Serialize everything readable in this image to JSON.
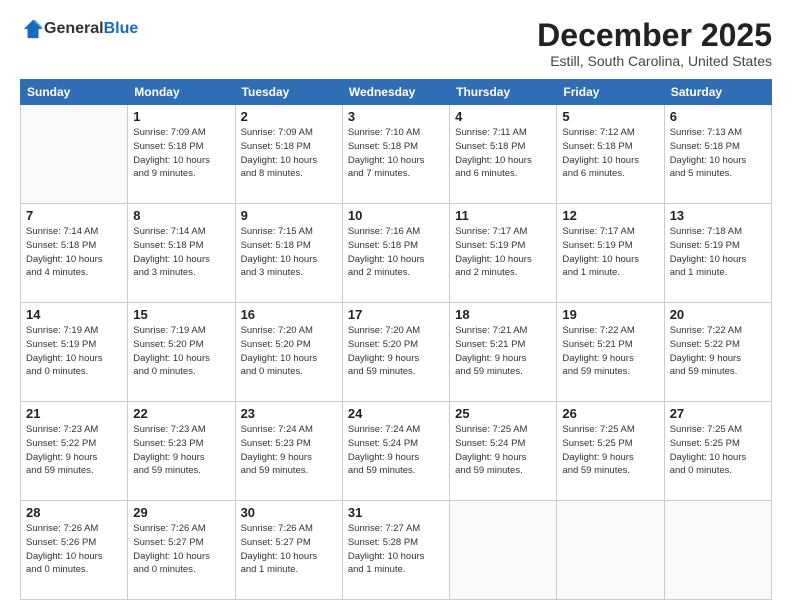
{
  "header": {
    "logo_general": "General",
    "logo_blue": "Blue",
    "month": "December 2025",
    "location": "Estill, South Carolina, United States"
  },
  "weekdays": [
    "Sunday",
    "Monday",
    "Tuesday",
    "Wednesday",
    "Thursday",
    "Friday",
    "Saturday"
  ],
  "weeks": [
    [
      {
        "day": "",
        "text": ""
      },
      {
        "day": "1",
        "text": "Sunrise: 7:09 AM\nSunset: 5:18 PM\nDaylight: 10 hours\nand 9 minutes."
      },
      {
        "day": "2",
        "text": "Sunrise: 7:09 AM\nSunset: 5:18 PM\nDaylight: 10 hours\nand 8 minutes."
      },
      {
        "day": "3",
        "text": "Sunrise: 7:10 AM\nSunset: 5:18 PM\nDaylight: 10 hours\nand 7 minutes."
      },
      {
        "day": "4",
        "text": "Sunrise: 7:11 AM\nSunset: 5:18 PM\nDaylight: 10 hours\nand 6 minutes."
      },
      {
        "day": "5",
        "text": "Sunrise: 7:12 AM\nSunset: 5:18 PM\nDaylight: 10 hours\nand 6 minutes."
      },
      {
        "day": "6",
        "text": "Sunrise: 7:13 AM\nSunset: 5:18 PM\nDaylight: 10 hours\nand 5 minutes."
      }
    ],
    [
      {
        "day": "7",
        "text": "Sunrise: 7:14 AM\nSunset: 5:18 PM\nDaylight: 10 hours\nand 4 minutes."
      },
      {
        "day": "8",
        "text": "Sunrise: 7:14 AM\nSunset: 5:18 PM\nDaylight: 10 hours\nand 3 minutes."
      },
      {
        "day": "9",
        "text": "Sunrise: 7:15 AM\nSunset: 5:18 PM\nDaylight: 10 hours\nand 3 minutes."
      },
      {
        "day": "10",
        "text": "Sunrise: 7:16 AM\nSunset: 5:18 PM\nDaylight: 10 hours\nand 2 minutes."
      },
      {
        "day": "11",
        "text": "Sunrise: 7:17 AM\nSunset: 5:19 PM\nDaylight: 10 hours\nand 2 minutes."
      },
      {
        "day": "12",
        "text": "Sunrise: 7:17 AM\nSunset: 5:19 PM\nDaylight: 10 hours\nand 1 minute."
      },
      {
        "day": "13",
        "text": "Sunrise: 7:18 AM\nSunset: 5:19 PM\nDaylight: 10 hours\nand 1 minute."
      }
    ],
    [
      {
        "day": "14",
        "text": "Sunrise: 7:19 AM\nSunset: 5:19 PM\nDaylight: 10 hours\nand 0 minutes."
      },
      {
        "day": "15",
        "text": "Sunrise: 7:19 AM\nSunset: 5:20 PM\nDaylight: 10 hours\nand 0 minutes."
      },
      {
        "day": "16",
        "text": "Sunrise: 7:20 AM\nSunset: 5:20 PM\nDaylight: 10 hours\nand 0 minutes."
      },
      {
        "day": "17",
        "text": "Sunrise: 7:20 AM\nSunset: 5:20 PM\nDaylight: 9 hours\nand 59 minutes."
      },
      {
        "day": "18",
        "text": "Sunrise: 7:21 AM\nSunset: 5:21 PM\nDaylight: 9 hours\nand 59 minutes."
      },
      {
        "day": "19",
        "text": "Sunrise: 7:22 AM\nSunset: 5:21 PM\nDaylight: 9 hours\nand 59 minutes."
      },
      {
        "day": "20",
        "text": "Sunrise: 7:22 AM\nSunset: 5:22 PM\nDaylight: 9 hours\nand 59 minutes."
      }
    ],
    [
      {
        "day": "21",
        "text": "Sunrise: 7:23 AM\nSunset: 5:22 PM\nDaylight: 9 hours\nand 59 minutes."
      },
      {
        "day": "22",
        "text": "Sunrise: 7:23 AM\nSunset: 5:23 PM\nDaylight: 9 hours\nand 59 minutes."
      },
      {
        "day": "23",
        "text": "Sunrise: 7:24 AM\nSunset: 5:23 PM\nDaylight: 9 hours\nand 59 minutes."
      },
      {
        "day": "24",
        "text": "Sunrise: 7:24 AM\nSunset: 5:24 PM\nDaylight: 9 hours\nand 59 minutes."
      },
      {
        "day": "25",
        "text": "Sunrise: 7:25 AM\nSunset: 5:24 PM\nDaylight: 9 hours\nand 59 minutes."
      },
      {
        "day": "26",
        "text": "Sunrise: 7:25 AM\nSunset: 5:25 PM\nDaylight: 9 hours\nand 59 minutes."
      },
      {
        "day": "27",
        "text": "Sunrise: 7:25 AM\nSunset: 5:25 PM\nDaylight: 10 hours\nand 0 minutes."
      }
    ],
    [
      {
        "day": "28",
        "text": "Sunrise: 7:26 AM\nSunset: 5:26 PM\nDaylight: 10 hours\nand 0 minutes."
      },
      {
        "day": "29",
        "text": "Sunrise: 7:26 AM\nSunset: 5:27 PM\nDaylight: 10 hours\nand 0 minutes."
      },
      {
        "day": "30",
        "text": "Sunrise: 7:26 AM\nSunset: 5:27 PM\nDaylight: 10 hours\nand 1 minute."
      },
      {
        "day": "31",
        "text": "Sunrise: 7:27 AM\nSunset: 5:28 PM\nDaylight: 10 hours\nand 1 minute."
      },
      {
        "day": "",
        "text": ""
      },
      {
        "day": "",
        "text": ""
      },
      {
        "day": "",
        "text": ""
      }
    ]
  ]
}
